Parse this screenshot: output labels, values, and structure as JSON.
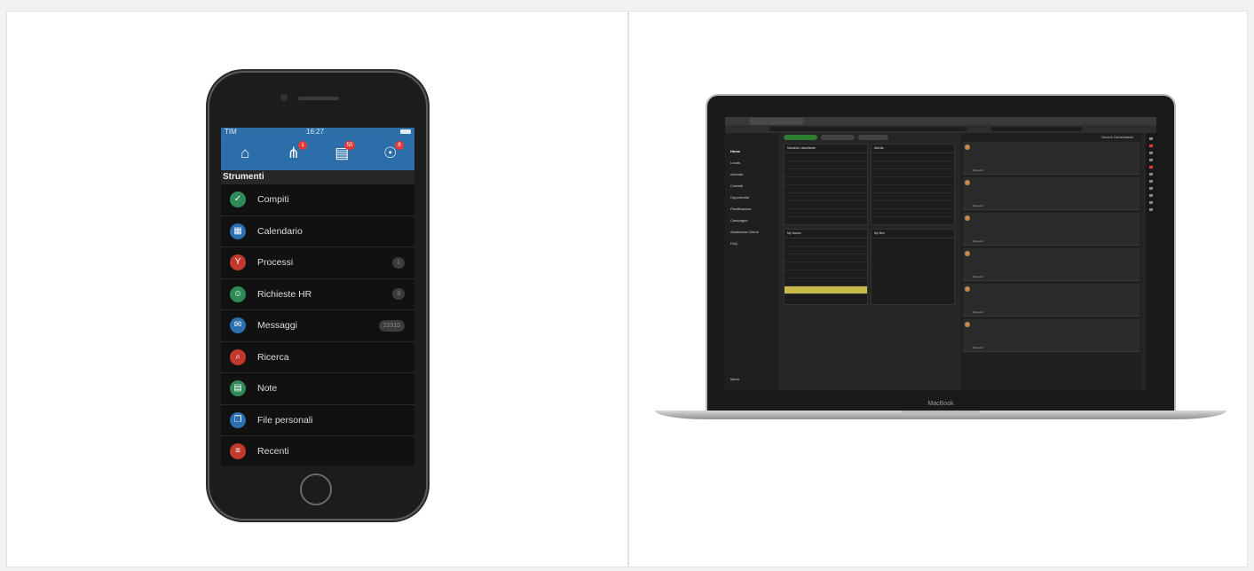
{
  "phone": {
    "status": {
      "carrier": "TIM",
      "time": "16:27"
    },
    "nav": [
      {
        "icon": "home-icon",
        "badge": ""
      },
      {
        "icon": "process-icon",
        "badge": "1"
      },
      {
        "icon": "chat-icon",
        "badge": "50"
      },
      {
        "icon": "globe-icon",
        "badge": "8"
      }
    ],
    "section_title": "Strumenti",
    "menu": [
      {
        "label": "Compiti",
        "icon": "check-icon",
        "color": "#2e8b57",
        "count": ""
      },
      {
        "label": "Calendario",
        "icon": "calendar-icon",
        "color": "#2a6fb0",
        "count": ""
      },
      {
        "label": "Processi",
        "icon": "process-icon",
        "color": "#c0392b",
        "count": "1"
      },
      {
        "label": "Richieste HR",
        "icon": "hr-icon",
        "color": "#2e8b57",
        "count": "3"
      },
      {
        "label": "Messaggi",
        "icon": "mail-icon",
        "color": "#2a6fb0",
        "count": "23310"
      },
      {
        "label": "Ricerca",
        "icon": "search-icon",
        "color": "#c0392b",
        "count": ""
      },
      {
        "label": "Note",
        "icon": "note-icon",
        "color": "#2e8b57",
        "count": ""
      },
      {
        "label": "File personali",
        "icon": "files-icon",
        "color": "#2a6fb0",
        "count": ""
      },
      {
        "label": "Recenti",
        "icon": "list-icon",
        "color": "#c0392b",
        "count": ""
      }
    ]
  },
  "laptop": {
    "brand": "MacBook",
    "sidebar": [
      "Home",
      "Leads",
      "Aziende",
      "Contatti",
      "Opportunita'",
      "Pianificazioni",
      "Campagne",
      "Assistenza Clienti",
      "FAQ"
    ],
    "sidebar_bottom": "Menù",
    "widgets": {
      "w1": "Mansioni classificate",
      "w2": "Attività",
      "w3": "My Issues",
      "w4": "My files"
    },
    "feed_head": "Cerca in Conversazioni",
    "reply": "Rispondi"
  }
}
